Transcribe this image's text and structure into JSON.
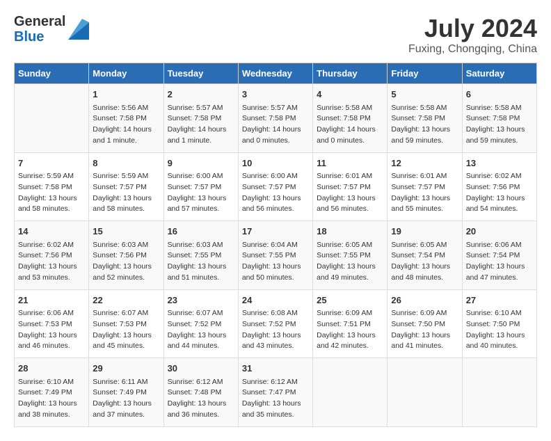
{
  "header": {
    "logo_general": "General",
    "logo_blue": "Blue",
    "month_year": "July 2024",
    "location": "Fuxing, Chongqing, China"
  },
  "days_of_week": [
    "Sunday",
    "Monday",
    "Tuesday",
    "Wednesday",
    "Thursday",
    "Friday",
    "Saturday"
  ],
  "weeks": [
    [
      {
        "day": "",
        "sunrise": "",
        "sunset": "",
        "daylight": ""
      },
      {
        "day": "1",
        "sunrise": "5:56 AM",
        "sunset": "7:58 PM",
        "daylight": "14 hours and 1 minute."
      },
      {
        "day": "2",
        "sunrise": "5:57 AM",
        "sunset": "7:58 PM",
        "daylight": "14 hours and 1 minute."
      },
      {
        "day": "3",
        "sunrise": "5:57 AM",
        "sunset": "7:58 PM",
        "daylight": "14 hours and 0 minutes."
      },
      {
        "day": "4",
        "sunrise": "5:58 AM",
        "sunset": "7:58 PM",
        "daylight": "14 hours and 0 minutes."
      },
      {
        "day": "5",
        "sunrise": "5:58 AM",
        "sunset": "7:58 PM",
        "daylight": "13 hours and 59 minutes."
      },
      {
        "day": "6",
        "sunrise": "5:58 AM",
        "sunset": "7:58 PM",
        "daylight": "13 hours and 59 minutes."
      }
    ],
    [
      {
        "day": "7",
        "sunrise": "5:59 AM",
        "sunset": "7:58 PM",
        "daylight": "13 hours and 58 minutes."
      },
      {
        "day": "8",
        "sunrise": "5:59 AM",
        "sunset": "7:57 PM",
        "daylight": "13 hours and 58 minutes."
      },
      {
        "day": "9",
        "sunrise": "6:00 AM",
        "sunset": "7:57 PM",
        "daylight": "13 hours and 57 minutes."
      },
      {
        "day": "10",
        "sunrise": "6:00 AM",
        "sunset": "7:57 PM",
        "daylight": "13 hours and 56 minutes."
      },
      {
        "day": "11",
        "sunrise": "6:01 AM",
        "sunset": "7:57 PM",
        "daylight": "13 hours and 56 minutes."
      },
      {
        "day": "12",
        "sunrise": "6:01 AM",
        "sunset": "7:57 PM",
        "daylight": "13 hours and 55 minutes."
      },
      {
        "day": "13",
        "sunrise": "6:02 AM",
        "sunset": "7:56 PM",
        "daylight": "13 hours and 54 minutes."
      }
    ],
    [
      {
        "day": "14",
        "sunrise": "6:02 AM",
        "sunset": "7:56 PM",
        "daylight": "13 hours and 53 minutes."
      },
      {
        "day": "15",
        "sunrise": "6:03 AM",
        "sunset": "7:56 PM",
        "daylight": "13 hours and 52 minutes."
      },
      {
        "day": "16",
        "sunrise": "6:03 AM",
        "sunset": "7:55 PM",
        "daylight": "13 hours and 51 minutes."
      },
      {
        "day": "17",
        "sunrise": "6:04 AM",
        "sunset": "7:55 PM",
        "daylight": "13 hours and 50 minutes."
      },
      {
        "day": "18",
        "sunrise": "6:05 AM",
        "sunset": "7:55 PM",
        "daylight": "13 hours and 49 minutes."
      },
      {
        "day": "19",
        "sunrise": "6:05 AM",
        "sunset": "7:54 PM",
        "daylight": "13 hours and 48 minutes."
      },
      {
        "day": "20",
        "sunrise": "6:06 AM",
        "sunset": "7:54 PM",
        "daylight": "13 hours and 47 minutes."
      }
    ],
    [
      {
        "day": "21",
        "sunrise": "6:06 AM",
        "sunset": "7:53 PM",
        "daylight": "13 hours and 46 minutes."
      },
      {
        "day": "22",
        "sunrise": "6:07 AM",
        "sunset": "7:53 PM",
        "daylight": "13 hours and 45 minutes."
      },
      {
        "day": "23",
        "sunrise": "6:07 AM",
        "sunset": "7:52 PM",
        "daylight": "13 hours and 44 minutes."
      },
      {
        "day": "24",
        "sunrise": "6:08 AM",
        "sunset": "7:52 PM",
        "daylight": "13 hours and 43 minutes."
      },
      {
        "day": "25",
        "sunrise": "6:09 AM",
        "sunset": "7:51 PM",
        "daylight": "13 hours and 42 minutes."
      },
      {
        "day": "26",
        "sunrise": "6:09 AM",
        "sunset": "7:50 PM",
        "daylight": "13 hours and 41 minutes."
      },
      {
        "day": "27",
        "sunrise": "6:10 AM",
        "sunset": "7:50 PM",
        "daylight": "13 hours and 40 minutes."
      }
    ],
    [
      {
        "day": "28",
        "sunrise": "6:10 AM",
        "sunset": "7:49 PM",
        "daylight": "13 hours and 38 minutes."
      },
      {
        "day": "29",
        "sunrise": "6:11 AM",
        "sunset": "7:49 PM",
        "daylight": "13 hours and 37 minutes."
      },
      {
        "day": "30",
        "sunrise": "6:12 AM",
        "sunset": "7:48 PM",
        "daylight": "13 hours and 36 minutes."
      },
      {
        "day": "31",
        "sunrise": "6:12 AM",
        "sunset": "7:47 PM",
        "daylight": "13 hours and 35 minutes."
      },
      {
        "day": "",
        "sunrise": "",
        "sunset": "",
        "daylight": ""
      },
      {
        "day": "",
        "sunrise": "",
        "sunset": "",
        "daylight": ""
      },
      {
        "day": "",
        "sunrise": "",
        "sunset": "",
        "daylight": ""
      }
    ]
  ]
}
